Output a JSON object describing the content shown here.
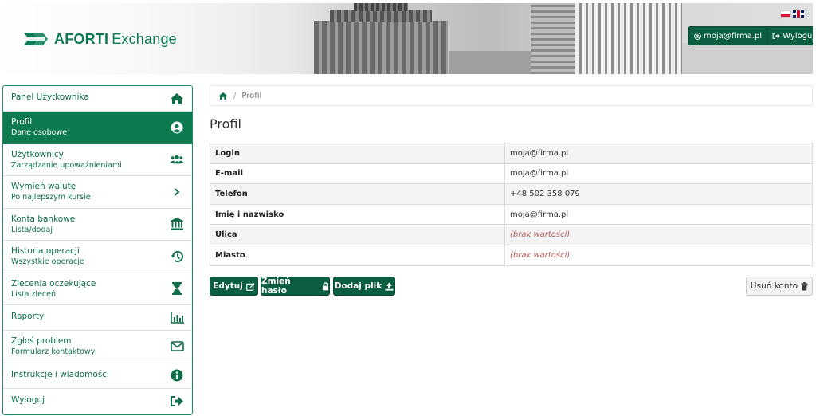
{
  "header": {
    "logo_brand": "AFORTI",
    "logo_product": "Exchange",
    "user_email": "moja@firma.pl",
    "logout_label": "Wyloguj",
    "languages": [
      "pl",
      "en"
    ]
  },
  "sidebar": {
    "items": [
      {
        "title": "Panel Użytkownika",
        "subtitle": "",
        "icon": "home-icon"
      },
      {
        "title": "Profil",
        "subtitle": "Dane osobowe",
        "icon": "user-circle-icon"
      },
      {
        "title": "Użytkownicy",
        "subtitle": "Zarządzanie upoważnieniami",
        "icon": "users-icon"
      },
      {
        "title": "Wymień walutę",
        "subtitle": "Po najlepszym kursie",
        "icon": "chevron-right-icon"
      },
      {
        "title": "Konta bankowe",
        "subtitle": "Lista/dodaj",
        "icon": "bank-icon"
      },
      {
        "title": "Historia operacji",
        "subtitle": "Wszystkie operacje",
        "icon": "history-icon"
      },
      {
        "title": "Zlecenia oczekujące",
        "subtitle": "Lista zleceń",
        "icon": "hourglass-icon"
      },
      {
        "title": "Raporty",
        "subtitle": "",
        "icon": "chart-icon"
      },
      {
        "title": "Zgłoś problem",
        "subtitle": "Formularz kontaktowy",
        "icon": "envelope-icon"
      },
      {
        "title": "Instrukcje i wiadomości",
        "subtitle": "",
        "icon": "info-icon"
      },
      {
        "title": "Wyloguj",
        "subtitle": "",
        "icon": "sign-out-icon"
      }
    ],
    "active_index": 1
  },
  "breadcrumb": {
    "current": "Profil"
  },
  "page_title": "Profil",
  "profile": {
    "rows": [
      {
        "label": "Login",
        "value": "moja@firma.pl",
        "empty": false
      },
      {
        "label": "E-mail",
        "value": "moja@firma.pl",
        "empty": false
      },
      {
        "label": "Telefon",
        "value": "+48 502 358 079",
        "empty": false
      },
      {
        "label": "Imię i nazwisko",
        "value": "moja@firma.pl",
        "empty": false
      },
      {
        "label": "Ulica",
        "value": "(brak wartości)",
        "empty": true
      },
      {
        "label": "Miasto",
        "value": "(brak wartości)",
        "empty": true
      }
    ]
  },
  "actions": {
    "edit_label": "Edytuj",
    "change_password_label": "Zmień hasło",
    "add_file_label": "Dodaj plik",
    "delete_account_label": "Usuń konto"
  },
  "colors": {
    "brand_green": "#0d7a4f",
    "button_green": "#0b5e40",
    "empty_value": "#b55a5a"
  }
}
